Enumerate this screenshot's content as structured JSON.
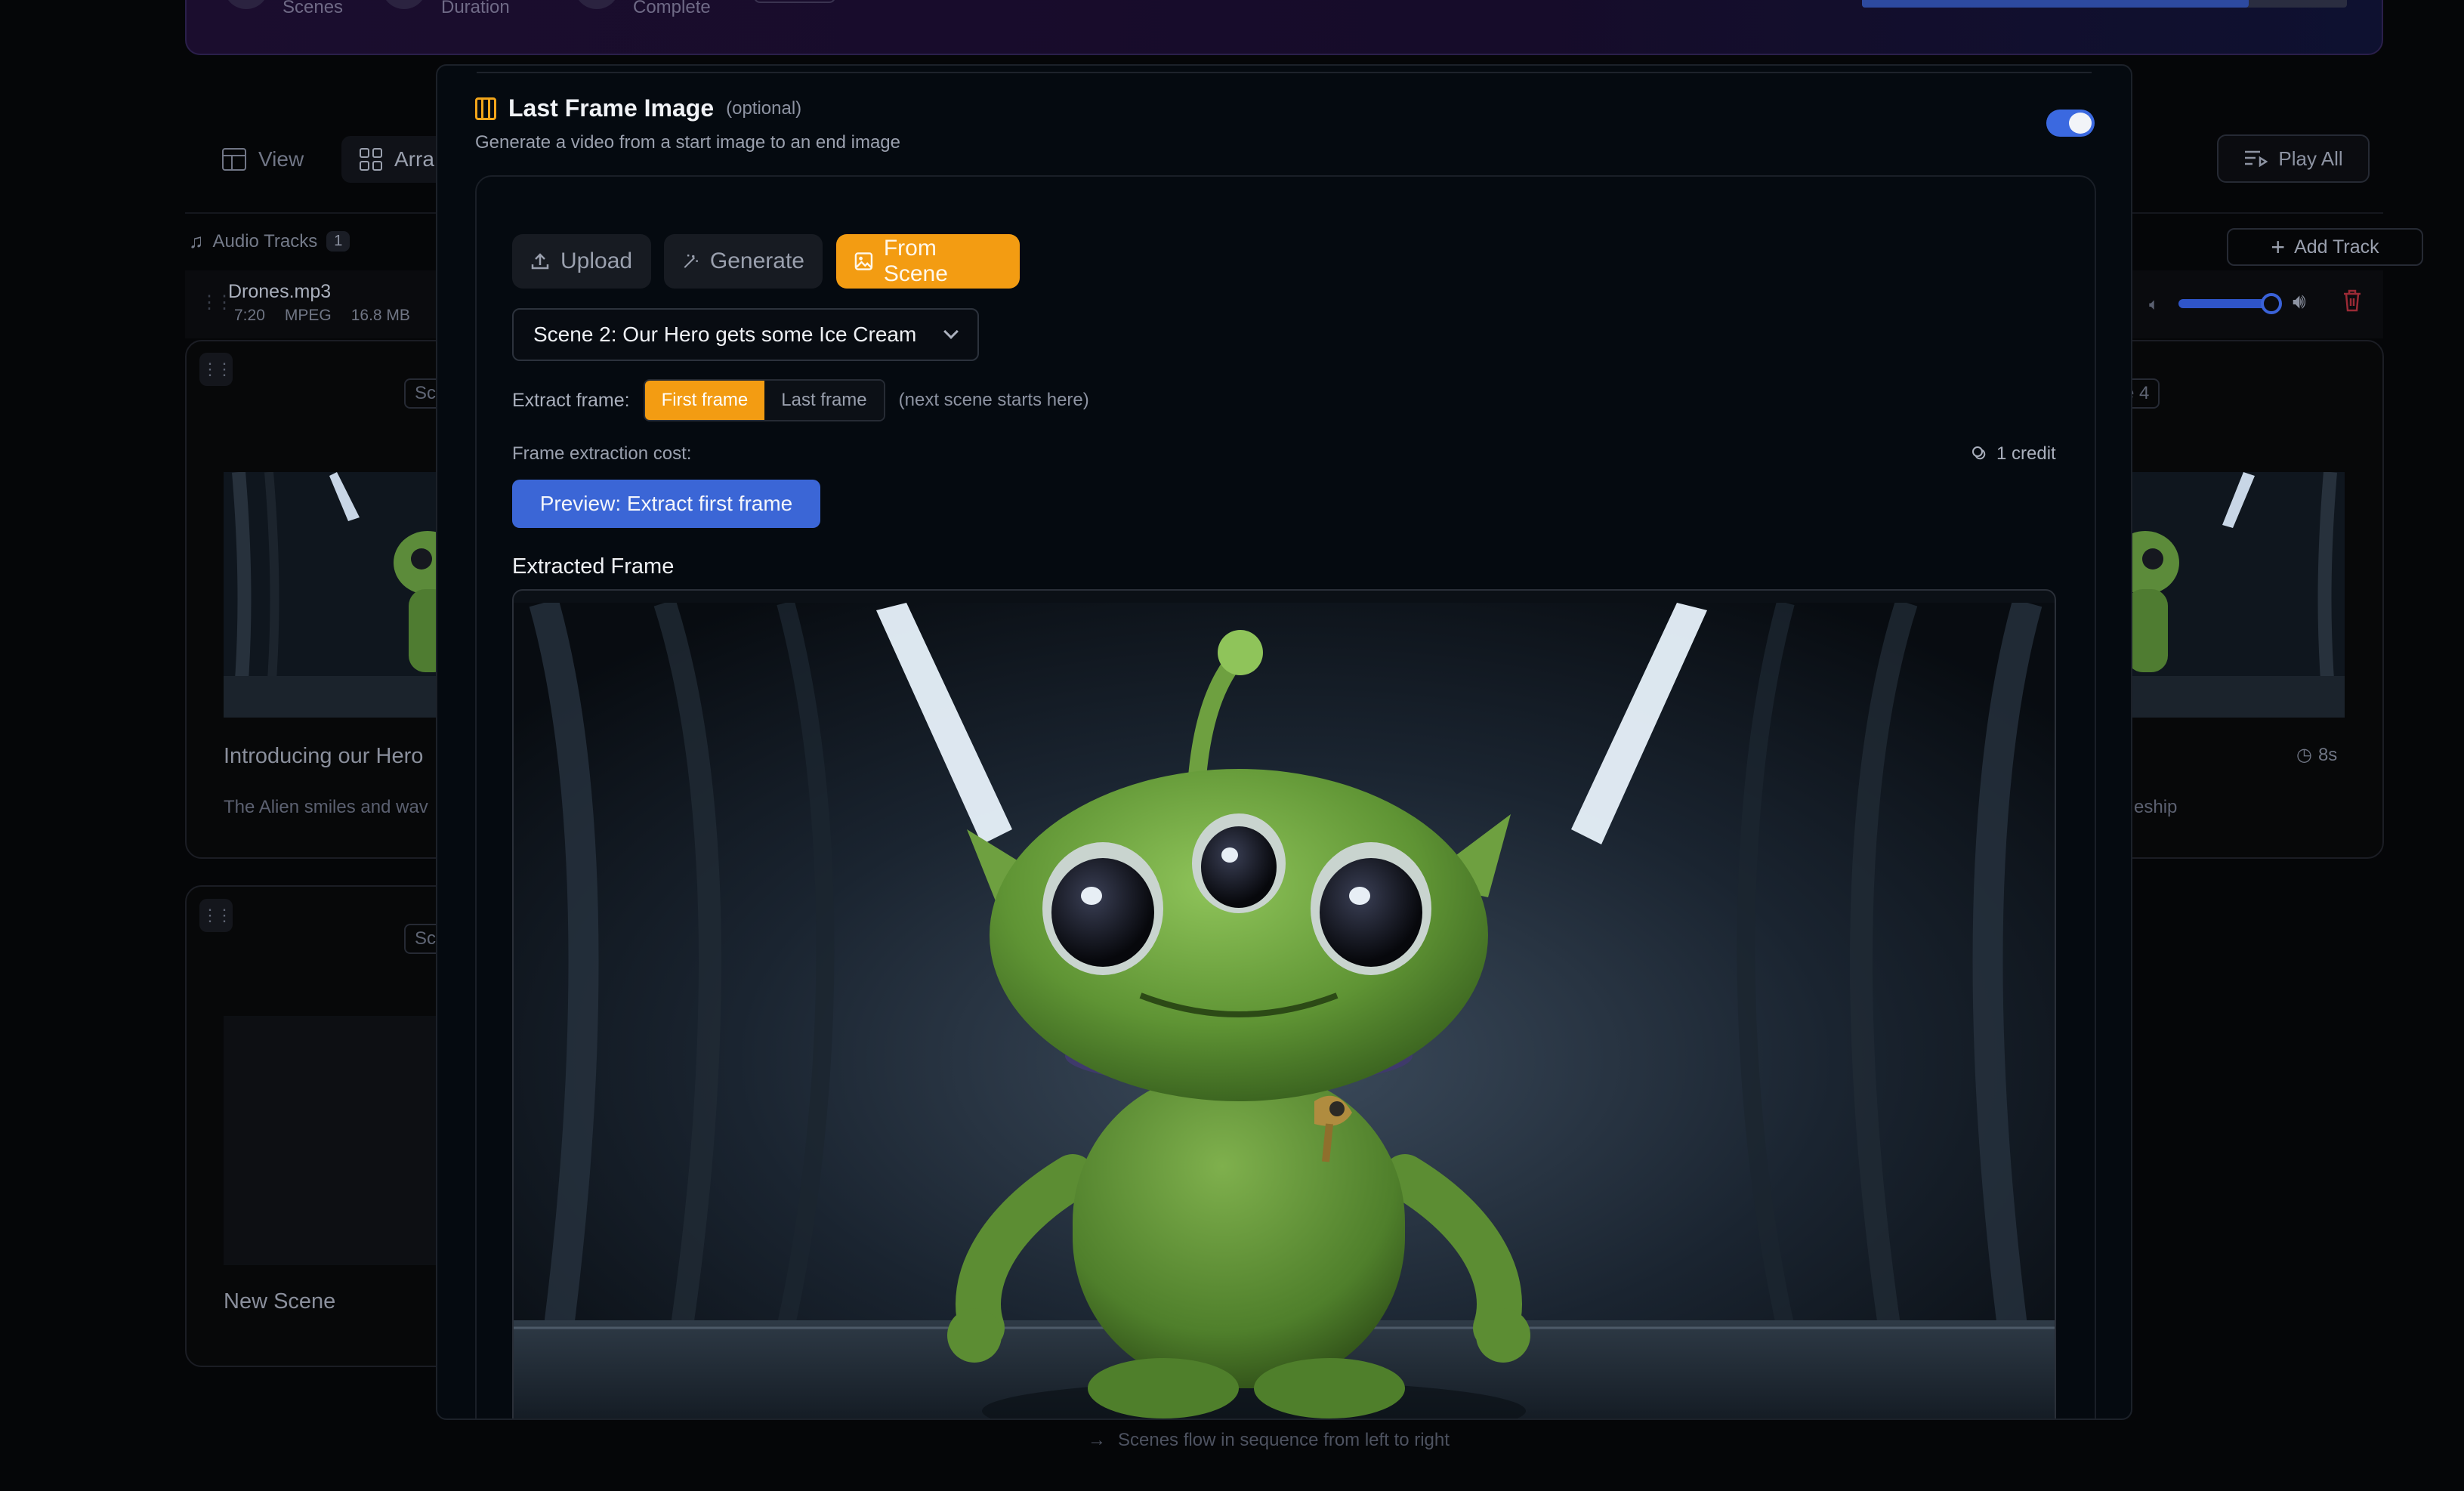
{
  "header": {
    "stats": [
      {
        "label": "Scenes"
      },
      {
        "label": "Duration"
      },
      {
        "label": "Complete"
      }
    ],
    "progress": 0.8
  },
  "toolbar": {
    "view_label": "View",
    "arrange_label": "Arra",
    "play_all_label": "Play All"
  },
  "audio": {
    "label": "Audio Tracks",
    "count": "1",
    "add_track_label": "Add Track",
    "track": {
      "name": "Drones.mp3",
      "duration": "7:20",
      "format": "MPEG",
      "size": "16.8 MB"
    }
  },
  "scenes": {
    "card1": {
      "chip": "Sc",
      "title": "Introducing our Hero",
      "desc": "The Alien smiles and wav"
    },
    "card2": {
      "chip": "Sc",
      "title": "New Scene"
    },
    "card3": {
      "chip": "e 4",
      "duration": "8s",
      "desc": "eship"
    }
  },
  "footer_note": "Scenes flow in sequence from left to right",
  "modal": {
    "title": "Last Frame Image",
    "optional": "(optional)",
    "subtitle": "Generate a video from a start image to an end image",
    "toggle_on": true,
    "tabs": {
      "upload": "Upload",
      "generate": "Generate",
      "from_scene": "From Scene"
    },
    "scene_select": "Scene 2: Our Hero gets some Ice Cream",
    "extract_label": "Extract frame:",
    "first_frame": "First frame",
    "last_frame": "Last frame",
    "hint": "(next scene starts here)",
    "cost_label": "Frame extraction cost:",
    "credit": "1 credit",
    "preview_button": "Preview: Extract first frame",
    "extracted_label": "Extracted Frame"
  },
  "colors": {
    "accent_orange": "#f39c12",
    "accent_blue": "#3b66d6",
    "danger": "#8a2730"
  }
}
